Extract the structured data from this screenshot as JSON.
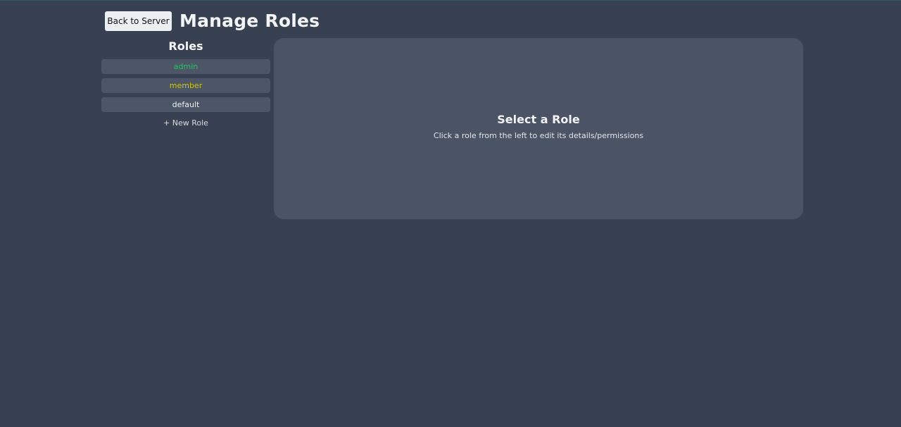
{
  "header": {
    "back_button_label": "Back to Server",
    "title": "Manage Roles"
  },
  "sidebar": {
    "title": "Roles",
    "roles": [
      {
        "label": "admin",
        "color": "#22c55e"
      },
      {
        "label": "member",
        "color": "#c8c800"
      },
      {
        "label": "default",
        "color": "#f0f2f5"
      }
    ],
    "new_role_label": "+ New Role"
  },
  "main": {
    "heading": "Select a Role",
    "subtitle": "Click a role from the left to edit its details/permissions"
  }
}
